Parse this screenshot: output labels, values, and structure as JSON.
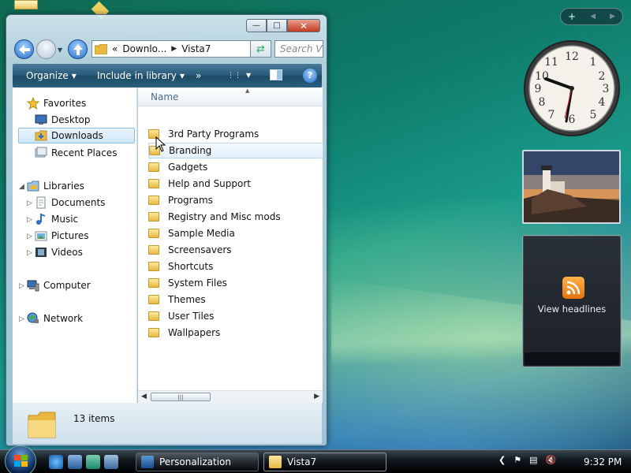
{
  "window": {
    "address": {
      "crumbs_prefix": "«",
      "crumb1": "Downlo...",
      "crumb2": "Vista7"
    },
    "search_placeholder": "Search Vi",
    "commands": {
      "organize": "Organize",
      "include": "Include in library",
      "more": "»",
      "help": "?"
    },
    "nav": {
      "favorites": "Favorites",
      "desktop": "Desktop",
      "downloads": "Downloads",
      "recent": "Recent Places",
      "libraries": "Libraries",
      "documents": "Documents",
      "music": "Music",
      "pictures": "Pictures",
      "videos": "Videos",
      "computer": "Computer",
      "network": "Network"
    },
    "column_header": "Name",
    "files": [
      "3rd Party Programs",
      "Branding",
      "Gadgets",
      "Help and Support",
      "Programs",
      "Registry and Misc mods",
      "Sample Media",
      "Screensavers",
      "Shortcuts",
      "System Files",
      "Themes",
      "User Tiles",
      "Wallpapers"
    ],
    "status": "13 items"
  },
  "sidebar": {
    "feed_label": "View headlines",
    "toolbar_add": "+"
  },
  "taskbar": {
    "buttons": [
      "Personalization",
      "Vista7"
    ],
    "time": "9:32 PM"
  },
  "colors": {
    "accent": "#2a6fc8",
    "cmdbar": "#2a5a7a",
    "folder": "#e8b840"
  }
}
